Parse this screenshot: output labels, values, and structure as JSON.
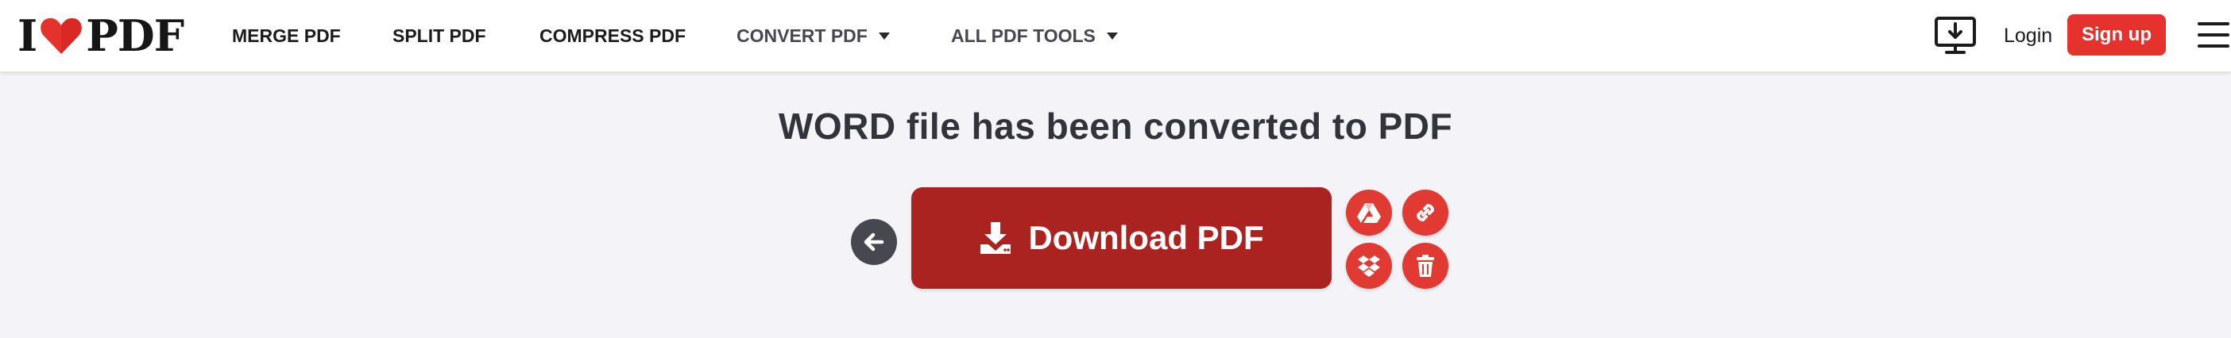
{
  "header": {
    "logo": {
      "prefix": "I",
      "suffix": "PDF",
      "heart_color": "#e5322d"
    },
    "nav": {
      "merge": "MERGE PDF",
      "split": "SPLIT PDF",
      "compress": "COMPRESS PDF",
      "convert": "CONVERT PDF",
      "all_tools": "ALL PDF TOOLS"
    },
    "login": "Login",
    "signup": "Sign up",
    "icons": {
      "desktop": "desktop-download-icon",
      "menu": "hamburger-menu-icon"
    }
  },
  "main": {
    "title": "WORD file has been converted to PDF",
    "download_label": "Download PDF",
    "icons": {
      "back": "arrow-left-icon",
      "download": "download-icon",
      "google_drive": "google-drive-icon",
      "link": "link-icon",
      "dropbox": "dropbox-icon",
      "delete": "trash-icon"
    }
  },
  "colors": {
    "brand_red": "#e5322d",
    "download_red": "#ab2320",
    "action_red": "#e03a33",
    "back_gray": "#47474f",
    "background": "#f4f4f8"
  }
}
